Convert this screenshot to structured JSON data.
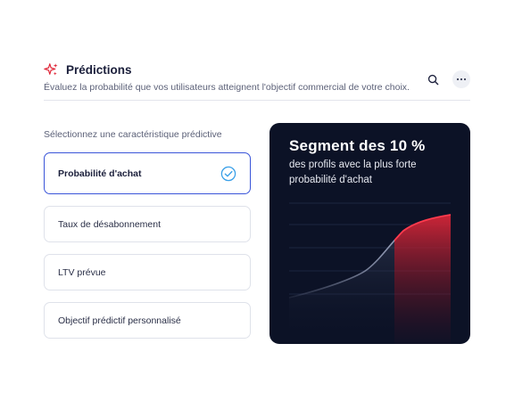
{
  "header": {
    "title": "Prédictions",
    "subtitle": "Évaluez la probabilité que vos utilisateurs atteignent l'objectif commercial de votre choix."
  },
  "section_label": "Sélectionnez une caractéristique prédictive",
  "options": [
    {
      "label": "Probabilité d'achat",
      "selected": true
    },
    {
      "label": "Taux de désabonnement",
      "selected": false
    },
    {
      "label": "LTV prévue",
      "selected": false
    },
    {
      "label": "Objectif prédictif personnalisé",
      "selected": false
    }
  ],
  "card": {
    "title": "Segment des 10 %",
    "subtitle": "des profils avec la plus forte probabilité d'achat"
  },
  "colors": {
    "accent": "#3a55d9",
    "card_bg": "#0c1226",
    "highlight": "#e0283a"
  }
}
